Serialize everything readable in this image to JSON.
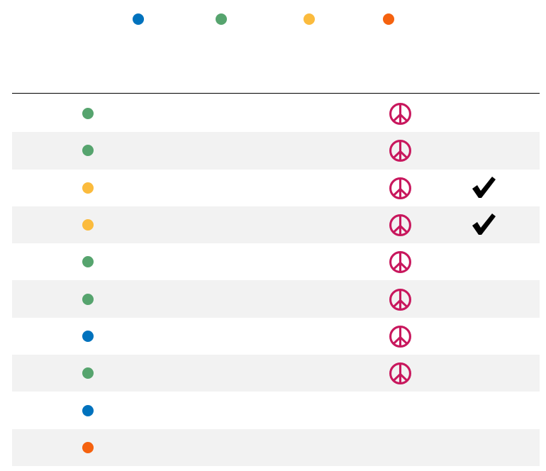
{
  "colors": {
    "blue": "#0072bd",
    "green": "#56a46e",
    "yellow": "#fbbb3d",
    "orange": "#f5620f",
    "peace_symbol": "#c8175d",
    "row_stripe": "#f2f2f2"
  },
  "legend": [
    {
      "icon": "blue-dot-icon",
      "color": "#0072bd"
    },
    {
      "icon": "green-dot-icon",
      "color": "#56a46e"
    },
    {
      "icon": "yellow-dot-icon",
      "color": "#fbbb3d"
    },
    {
      "icon": "orange-dot-icon",
      "color": "#f5620f"
    }
  ],
  "rows": [
    {
      "status_color": "#56a46e",
      "peace_icon": true,
      "check_icon": false
    },
    {
      "status_color": "#56a46e",
      "peace_icon": true,
      "check_icon": false
    },
    {
      "status_color": "#fbbb3d",
      "peace_icon": true,
      "check_icon": true
    },
    {
      "status_color": "#fbbb3d",
      "peace_icon": true,
      "check_icon": true
    },
    {
      "status_color": "#56a46e",
      "peace_icon": true,
      "check_icon": false
    },
    {
      "status_color": "#56a46e",
      "peace_icon": true,
      "check_icon": false
    },
    {
      "status_color": "#0072bd",
      "peace_icon": true,
      "check_icon": false
    },
    {
      "status_color": "#56a46e",
      "peace_icon": true,
      "check_icon": false
    },
    {
      "status_color": "#0072bd",
      "peace_icon": false,
      "check_icon": false
    },
    {
      "status_color": "#f5620f",
      "peace_icon": false,
      "check_icon": false
    }
  ]
}
